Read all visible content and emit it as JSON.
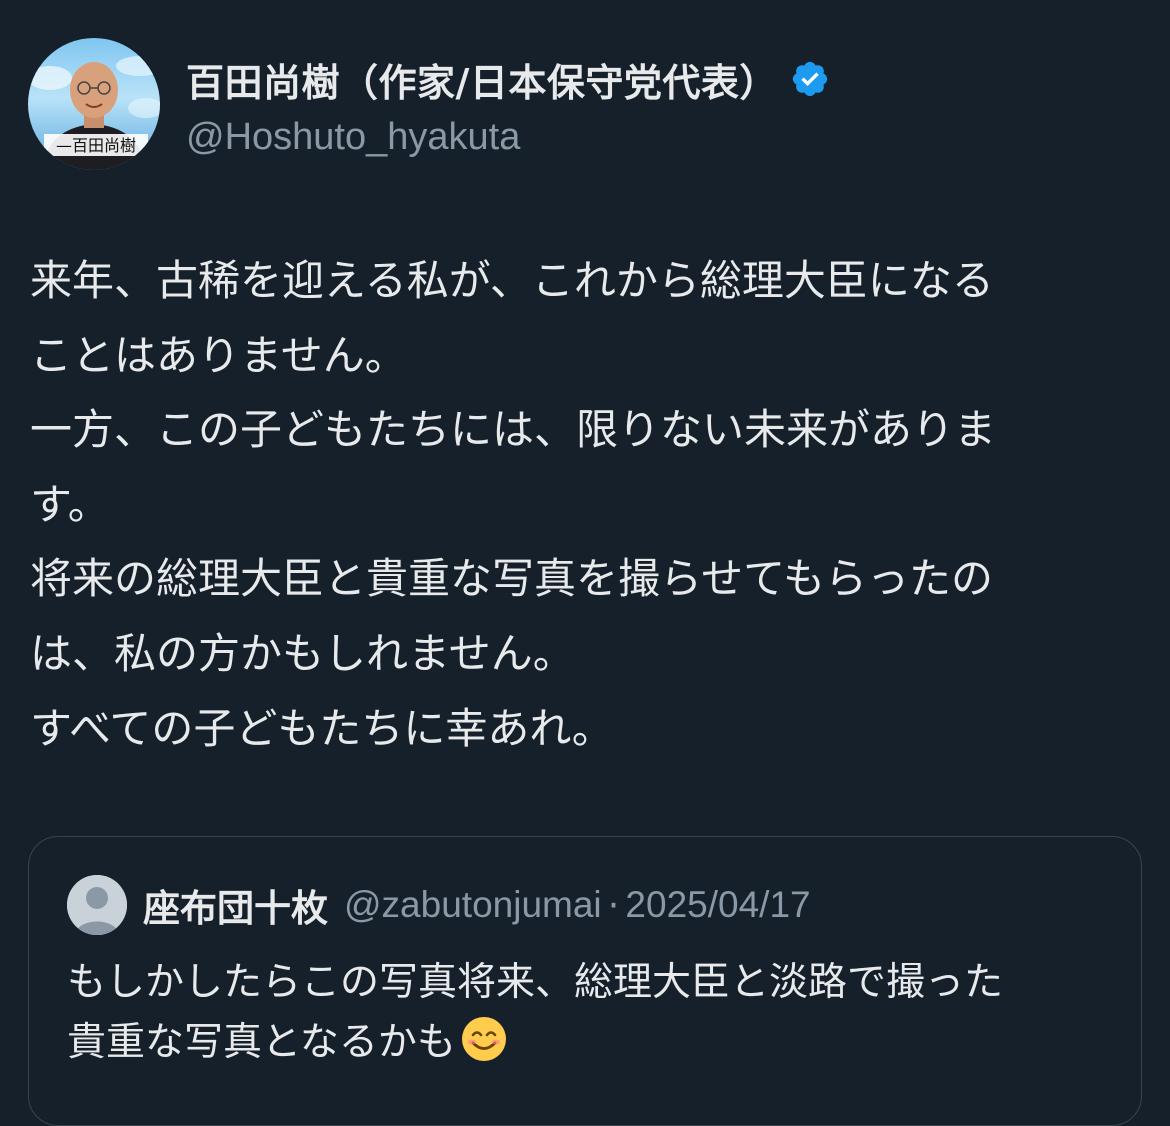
{
  "author": {
    "display_name": "百田尚樹（作家/日本保守党代表）",
    "handle": "@Hoshuto_hyakuta",
    "verified": true,
    "verified_color": "#1d9bf0",
    "avatar_icon": "profile-photo-avatar"
  },
  "tweet": {
    "lines": [
      "来年、古稀を迎える私が、これから総理大臣になる",
      "ことはありません。",
      "一方、この子どもたちには、限りない未来がありま",
      "す。",
      "将来の総理大臣と貴重な写真を撮らせてもらったの",
      "は、私の方かもしれません。",
      "すべての子どもたちに幸あれ。"
    ]
  },
  "quote": {
    "display_name": "座布団十枚",
    "handle": "@zabutonjumai",
    "separator": "·",
    "date": "2025/04/17",
    "avatar_icon": "default-user-avatar-icon",
    "lines": [
      "もしかしたらこの写真将来、総理大臣と淡路で撮った",
      "貴重な写真となるかも"
    ],
    "emoji": "smiling-face-emoji"
  },
  "colors": {
    "background": "#15202b",
    "text": "#e7e9ea",
    "secondary_text": "#8b98a5",
    "border": "#38444d"
  }
}
